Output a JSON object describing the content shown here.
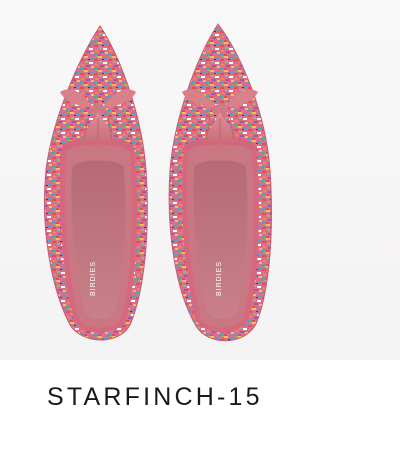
{
  "product": {
    "name": "STARFINCH-15",
    "image_alt": "Pink multicolor tweed tassel loafer flats, top view",
    "insole_brand": "BIRDIES"
  },
  "colors": {
    "tweed_base": "#d86a86",
    "lining": "#c87b83",
    "tassel": "#d9818b",
    "text": "#1a1a1a"
  }
}
